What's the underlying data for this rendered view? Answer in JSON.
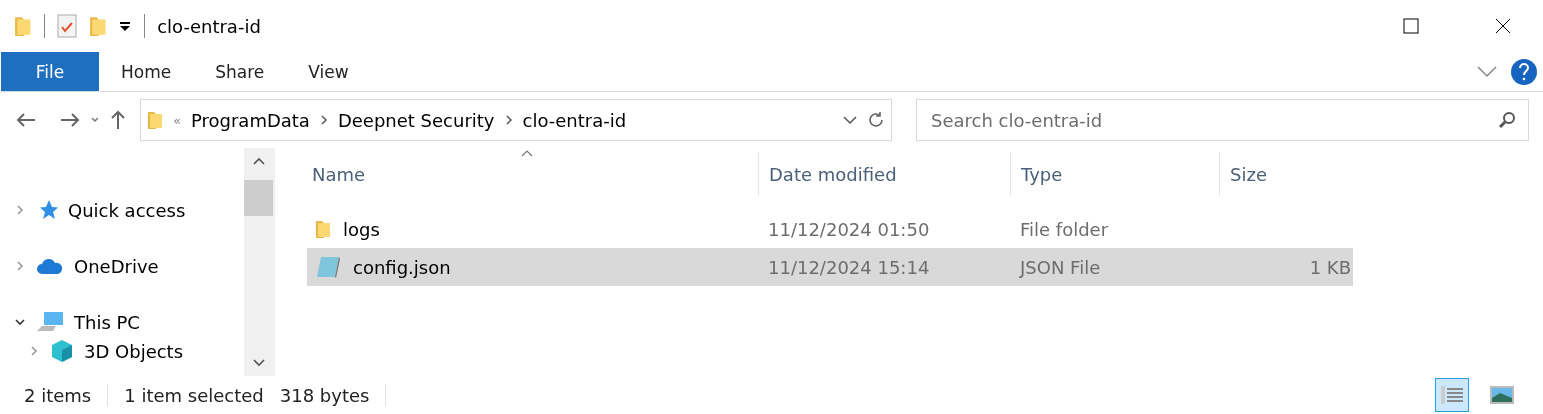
{
  "window": {
    "title": "clo-entra-id"
  },
  "ribbon_tabs": [
    {
      "label": "File",
      "selected": true
    },
    {
      "label": "Home",
      "selected": false
    },
    {
      "label": "Share",
      "selected": false
    },
    {
      "label": "View",
      "selected": false
    }
  ],
  "address": {
    "overflow": "«",
    "crumbs": [
      "ProgramData",
      "Deepnet Security",
      "clo-entra-id"
    ]
  },
  "search": {
    "placeholder": "Search clo-entra-id"
  },
  "nav_tree": [
    {
      "label": "Quick access",
      "kind": "star",
      "expanded": false
    },
    {
      "label": "OneDrive",
      "kind": "cloud",
      "expanded": false
    },
    {
      "label": "This PC",
      "kind": "pc",
      "expanded": true,
      "children": [
        {
          "label": "3D Objects",
          "kind": "cube",
          "expanded": false
        }
      ]
    }
  ],
  "table": {
    "columns": [
      "Name",
      "Date modified",
      "Type",
      "Size"
    ],
    "rows": [
      {
        "kind": "folder",
        "selected": false,
        "cells": [
          "logs",
          "11/12/2024 01:50",
          "File folder",
          ""
        ]
      },
      {
        "kind": "file",
        "selected": true,
        "cells": [
          "config.json",
          "11/12/2024 15:14",
          "JSON File",
          "1 KB"
        ]
      }
    ]
  },
  "status_bar": {
    "count": "2 items",
    "selection": "1 item selected",
    "size": "318 bytes"
  },
  "views": [
    {
      "kind": "details",
      "selected": true
    },
    {
      "kind": "large",
      "selected": false
    }
  ]
}
